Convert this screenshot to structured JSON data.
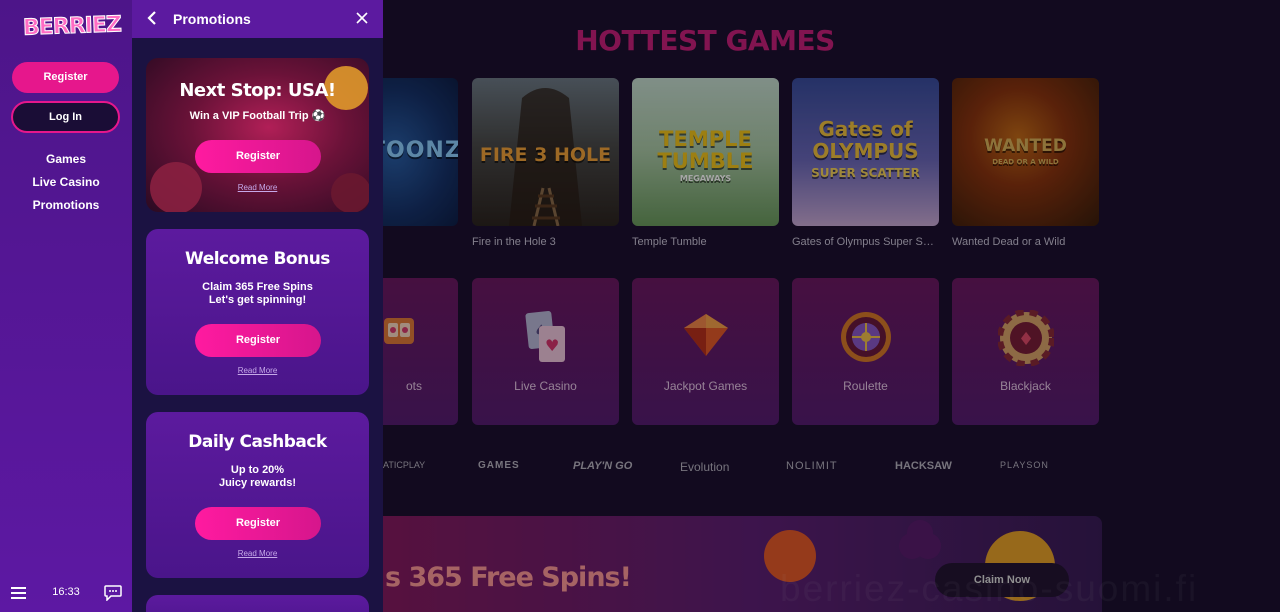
{
  "main": {
    "section_title": "HOTTEST GAMES",
    "games": [
      {
        "name": "",
        "logo": "TOONZ"
      },
      {
        "name": "Fire in the Hole 3",
        "logo": "FIRE 3 HOLE"
      },
      {
        "name": "Temple Tumble",
        "logo": "TEMPLE TUMBLE",
        "logo_sub": "MEGAWAYS"
      },
      {
        "name": "Gates of Olympus Super Scatt…",
        "logo": "Gates of OLYMPUS",
        "logo_sub": "SUPER SCATTER"
      },
      {
        "name": "Wanted Dead or a Wild",
        "logo": "WANTED",
        "logo_sub": "DEAD OR A WILD"
      }
    ],
    "categories": [
      {
        "label": "ots",
        "icon": "slot-machine-icon"
      },
      {
        "label": "Live Casino",
        "icon": "playing-cards-icon"
      },
      {
        "label": "Jackpot Games",
        "icon": "gem-icon"
      },
      {
        "label": "Roulette",
        "icon": "roulette-wheel-icon"
      },
      {
        "label": "Blackjack",
        "icon": "casino-chip-icon"
      }
    ],
    "providers": [
      "ATICPLAY",
      "GAMES",
      "PLAY'N GO",
      "Evolution",
      "NOLIMIT",
      "HACKSAW",
      "PLAYSON"
    ],
    "banner": {
      "text": "s 365 Free Spins!",
      "claim_label": "Claim Now"
    },
    "watermark": "berriez-casino-suomi.fi"
  },
  "sidebar": {
    "logo": "BERRIEZ",
    "register_label": "Register",
    "login_label": "Log In",
    "nav": [
      "Games",
      "Live Casino",
      "Promotions"
    ],
    "time": "16:33"
  },
  "panel": {
    "title": "Promotions",
    "cards": [
      {
        "title": "Next Stop: USA!",
        "subtitle": "Win a VIP Football Trip ⚽",
        "button": "Register",
        "link": "Read More"
      },
      {
        "title": "Welcome Bonus",
        "subtitle_line1": "Claim 365 Free Spins",
        "subtitle_line2": "Let's get spinning!",
        "button": "Register",
        "link": "Read More"
      },
      {
        "title": "Daily Cashback",
        "subtitle_line1": "Up to 20%",
        "subtitle_line2": "Juicy rewards!",
        "button": "Register",
        "link": "Read More"
      }
    ]
  },
  "colors": {
    "accent": "#e6178c",
    "sidebar": "#5d18a3",
    "panel": "#1b1242",
    "header": "#5c1aa0"
  }
}
